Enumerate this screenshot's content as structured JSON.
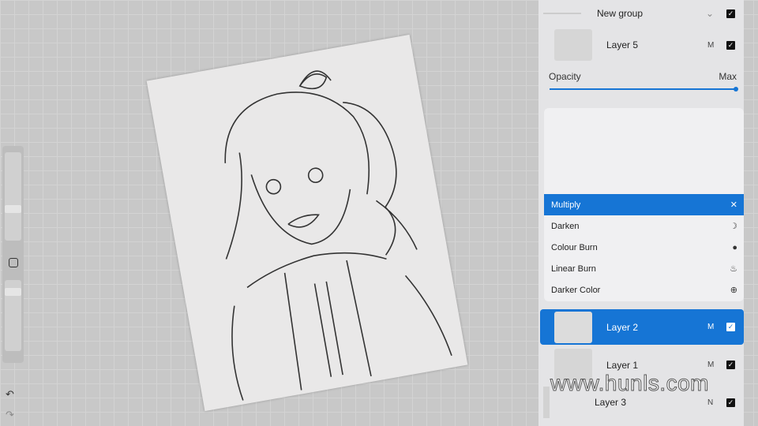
{
  "layers": {
    "group": {
      "label": "New group",
      "visible": true
    },
    "layer5": {
      "label": "Layer 5",
      "mode": "M",
      "visible": true
    },
    "opacity": {
      "label": "Opacity",
      "value_label": "Max",
      "value": 1.0
    },
    "layer2": {
      "label": "Layer 2",
      "mode": "M",
      "visible": true,
      "selected": true
    },
    "layer1": {
      "label": "Layer 1",
      "mode": "M",
      "visible": true
    },
    "layer3": {
      "label": "Layer 3",
      "mode": "N",
      "visible": true
    }
  },
  "blend_modes": [
    {
      "label": "Multiply",
      "icon": "multiply-icon",
      "glyph": "✕",
      "selected": true
    },
    {
      "label": "Darken",
      "icon": "moon-icon",
      "glyph": "☽"
    },
    {
      "label": "Colour Burn",
      "icon": "burn-icon",
      "glyph": "●"
    },
    {
      "label": "Linear Burn",
      "icon": "flame-icon",
      "glyph": "♨"
    },
    {
      "label": "Darker Color",
      "icon": "plus-circle-icon",
      "glyph": "⊕"
    }
  ],
  "sidebar": {
    "undo": "↶",
    "redo": "↷"
  },
  "watermark": "www.hunls.com",
  "colors": {
    "accent": "#1675d5"
  }
}
